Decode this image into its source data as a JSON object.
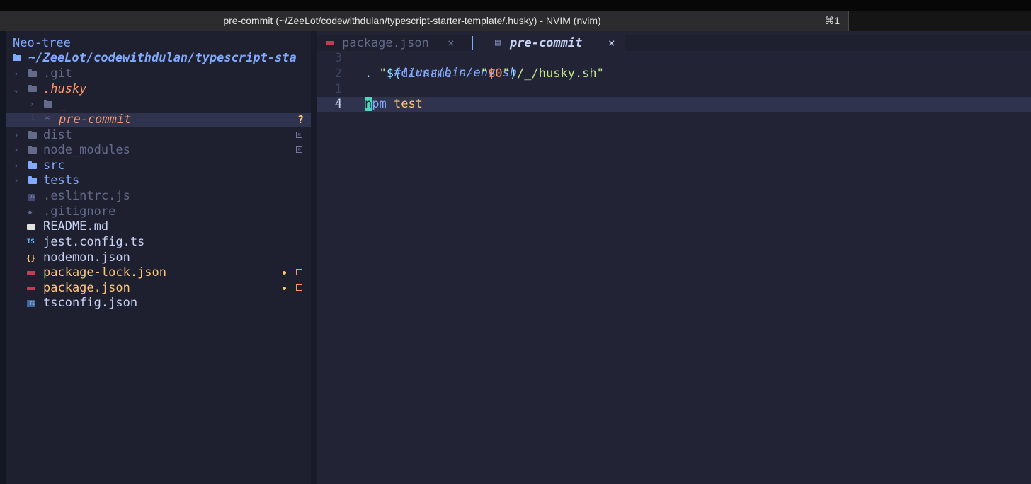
{
  "window": {
    "title": "pre-commit (~/ZeeLot/codewithdulan/typescript-starter-template/.husky) - NVIM (nvim)",
    "shortcut": "⌘1"
  },
  "sidebar": {
    "header": "Neo-tree",
    "root": "~/ZeeLot/codewithdulan/typescript-sta",
    "items": [
      {
        "label": ".git",
        "kind": "folder",
        "icon": "folder-icon"
      },
      {
        "label": ".husky",
        "kind": "folder-open",
        "icon": "folder-open-icon"
      },
      {
        "label": "_",
        "kind": "folder",
        "icon": "folder-icon"
      },
      {
        "label": "pre-commit",
        "kind": "file",
        "icon": "asterisk-icon",
        "status": "?"
      },
      {
        "label": "dist",
        "kind": "folder",
        "icon": "folder-icon"
      },
      {
        "label": "node_modules",
        "kind": "folder",
        "icon": "folder-icon"
      },
      {
        "label": "src",
        "kind": "folder",
        "icon": "folder-icon"
      },
      {
        "label": "tests",
        "kind": "folder",
        "icon": "folder-icon"
      },
      {
        "label": ".eslintrc.js",
        "kind": "file",
        "icon": "js-file-icon"
      },
      {
        "label": ".gitignore",
        "kind": "file",
        "icon": "git-file-icon"
      },
      {
        "label": "README.md",
        "kind": "file",
        "icon": "markdown-file-icon"
      },
      {
        "label": "jest.config.ts",
        "kind": "file",
        "icon": "ts-file-icon"
      },
      {
        "label": "nodemon.json",
        "kind": "file",
        "icon": "json-file-icon"
      },
      {
        "label": "package-lock.json",
        "kind": "file",
        "icon": "npm-file-icon"
      },
      {
        "label": "package.json",
        "kind": "file",
        "icon": "npm-file-icon"
      },
      {
        "label": "tsconfig.json",
        "kind": "file",
        "icon": "tsconfig-file-icon"
      }
    ]
  },
  "tabs": [
    {
      "label": "package.json",
      "icon": "npm-file-icon",
      "close": "×",
      "active": false
    },
    {
      "label": "pre-commit",
      "icon": "document-icon",
      "close": "×",
      "active": true
    }
  ],
  "editor": {
    "line_numbers": [
      "3",
      "2",
      "1",
      "4"
    ],
    "lines": {
      "l1": "#!/usr/bin/env sh",
      "l2_a": ". ",
      "l2_b": "\"",
      "l2_c": "$(",
      "l2_d": "dirname",
      "l2_e": " -- ",
      "l2_f": "\"",
      "l2_g": "$0",
      "l2_h": "\"",
      "l2_i": ")",
      "l2_j": "/_/husky.sh\"",
      "l4_cursor": "n",
      "l4_a": "pm",
      "l4_b": " test"
    }
  },
  "colors": {
    "folder": "#737aa2",
    "folder_active": "#82aaff",
    "modified": "#ffc777",
    "untracked": "#ff966c"
  }
}
